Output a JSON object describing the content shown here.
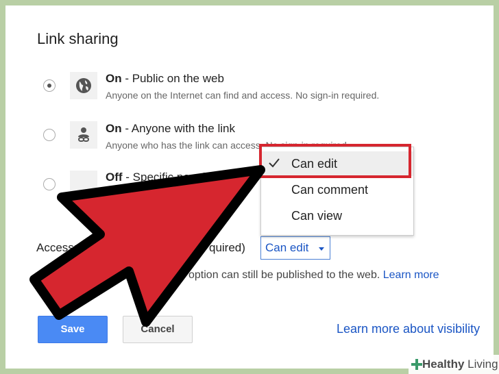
{
  "dialog": {
    "title": "Link sharing",
    "options": [
      {
        "strong": "On",
        "title_rest": " - Public on the web",
        "description": "Anyone on the Internet can find and access. No sign-in required.",
        "selected": true,
        "icon": "globe-icon"
      },
      {
        "strong": "On",
        "title_rest": " - Anyone with the link",
        "description": "Anyone who has the link can access. No sign-in required.",
        "selected": false,
        "icon": "link-person-icon"
      },
      {
        "strong": "Off",
        "title_rest": " - Specific people",
        "description": "",
        "selected": false,
        "icon": "person-icon"
      }
    ],
    "access": {
      "label_start": "Access:",
      "label_end": "quired)",
      "dropdown_value": "Can edit"
    },
    "publish_note_visible": "option can still be published to the web.",
    "publish_link": "Learn more",
    "save_label": "Save",
    "cancel_label": "Cancel",
    "learn_visibility": "Learn more about visibility"
  },
  "menu": {
    "items": [
      {
        "label": "Can edit",
        "checked": true
      },
      {
        "label": "Can comment",
        "checked": false
      },
      {
        "label": "Can view",
        "checked": false
      }
    ]
  },
  "overlay": {
    "arrow_color": "#d6262f",
    "highlight_color": "#d6262f"
  },
  "watermark": {
    "brand": "Healthy",
    "brand2": "Living"
  }
}
